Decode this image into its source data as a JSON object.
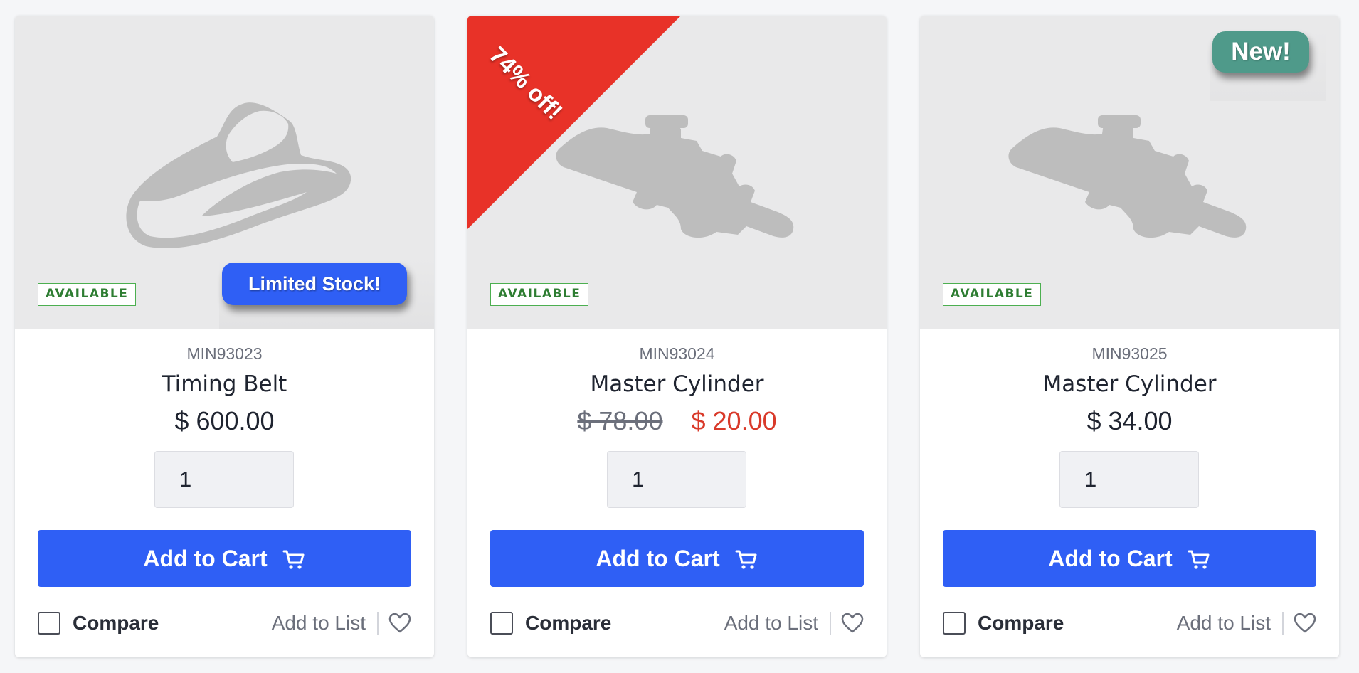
{
  "products": [
    {
      "sku": "MIN93023",
      "name": "Timing Belt",
      "price": "$ 600.00",
      "availability": "AVAILABLE",
      "promo_badge": "Limited Stock!",
      "quantity": "1",
      "add_to_cart_label": "Add to Cart",
      "compare_label": "Compare",
      "add_to_list_label": "Add to List",
      "image_icon": "timing-belt-icon"
    },
    {
      "sku": "MIN93024",
      "name": "Master Cylinder",
      "original_price": "$ 78.00",
      "sale_price": "$ 20.00",
      "availability": "AVAILABLE",
      "discount_badge": "74% off!",
      "quantity": "1",
      "add_to_cart_label": "Add to Cart",
      "compare_label": "Compare",
      "add_to_list_label": "Add to List",
      "image_icon": "master-cylinder-icon"
    },
    {
      "sku": "MIN93025",
      "name": "Master Cylinder",
      "price": "$ 34.00",
      "availability": "AVAILABLE",
      "promo_badge": "New!",
      "quantity": "1",
      "add_to_cart_label": "Add to Cart",
      "compare_label": "Compare",
      "add_to_list_label": "Add to List",
      "image_icon": "master-cylinder-icon"
    }
  ],
  "colors": {
    "primary_button": "#2f5ff5",
    "available_border": "#4caf50",
    "sale_price": "#d93a2a",
    "discount_ribbon": "#e83228",
    "new_badge": "#4f9a8a",
    "limited_badge": "#2f5ff5"
  }
}
